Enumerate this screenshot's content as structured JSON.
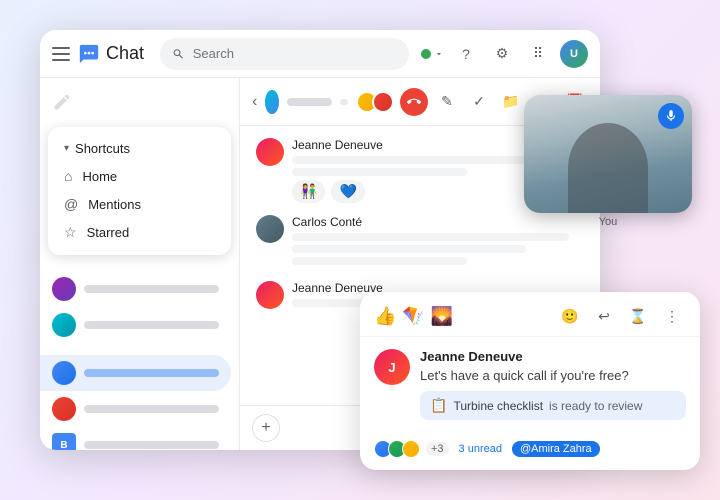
{
  "app": {
    "title": "Chat",
    "search_placeholder": "Search"
  },
  "shortcuts": {
    "label": "Shortcuts",
    "items": [
      {
        "id": "home",
        "icon": "⌂",
        "label": "Home"
      },
      {
        "id": "mentions",
        "icon": "@",
        "label": "Mentions"
      },
      {
        "id": "starred",
        "icon": "☆",
        "label": "Starred"
      }
    ]
  },
  "messages": [
    {
      "sender": "Jeanne Deneuve",
      "lines": 2,
      "reactions": [
        "👫",
        "💙"
      ]
    },
    {
      "sender": "Carlos Conté",
      "lines": 3
    }
  ],
  "message2": {
    "sender": "Jeanne Deneuve"
  },
  "video": {
    "label": "You"
  },
  "notification": {
    "sender": "Jeanne Deneuve",
    "message": "Let's have a quick call if you're free?",
    "attachment_icon": "📋",
    "attachment_text": "Turbine checklist",
    "attachment_status": "is ready to review",
    "unread_count": "+3",
    "unread_label": "3 unread",
    "mention": "@Amira Zahra"
  },
  "toolbar": {
    "reply_icon": "↩",
    "hourglass_icon": "⌛",
    "more_icon": "⋮",
    "emoji_icon": "🙂"
  },
  "emojis": {
    "thumbs_up": "👍",
    "kite": "🪁",
    "landscape": "🌄"
  }
}
